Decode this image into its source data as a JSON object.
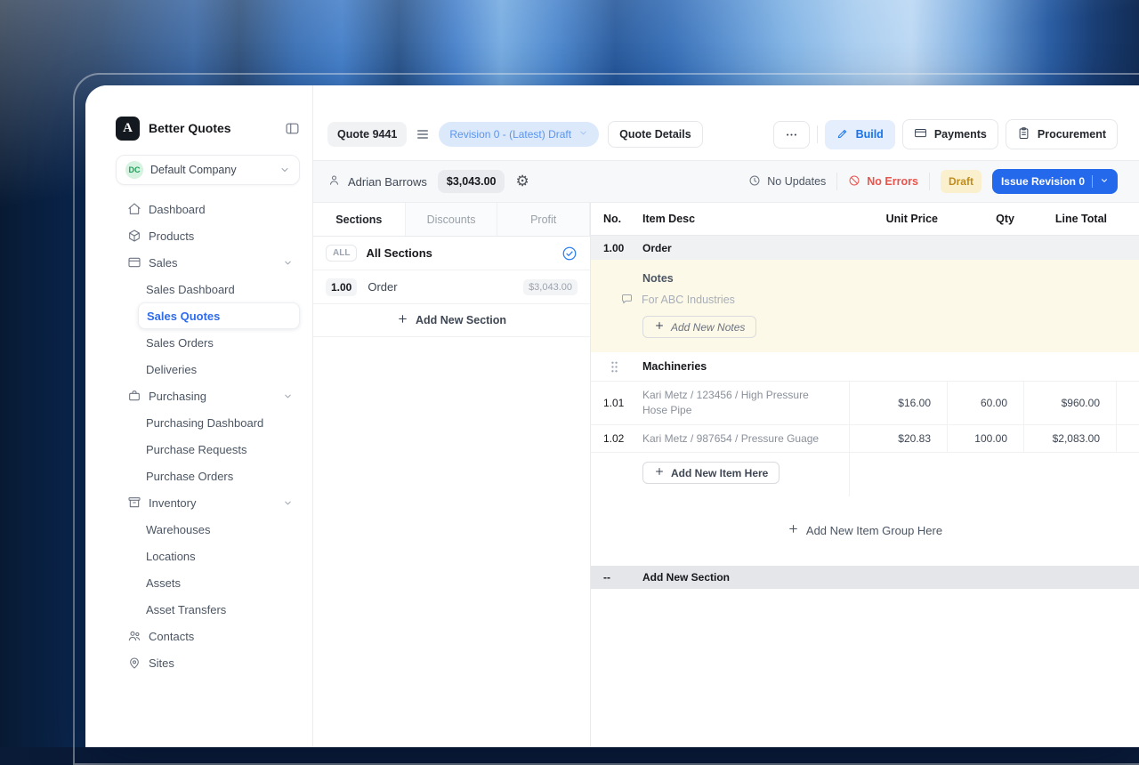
{
  "window": {
    "brand": "Better Quotes",
    "logo_letter": "A"
  },
  "sidebar": {
    "company": {
      "initials": "DC",
      "name": "Default Company"
    },
    "items": [
      {
        "label": "Dashboard"
      },
      {
        "label": "Products"
      },
      {
        "label": "Sales"
      },
      {
        "label": "Sales Dashboard"
      },
      {
        "label": "Sales Quotes"
      },
      {
        "label": "Sales Orders"
      },
      {
        "label": "Deliveries"
      },
      {
        "label": "Purchasing"
      },
      {
        "label": "Purchasing Dashboard"
      },
      {
        "label": "Purchase Requests"
      },
      {
        "label": "Purchase Orders"
      },
      {
        "label": "Inventory"
      },
      {
        "label": "Warehouses"
      },
      {
        "label": "Locations"
      },
      {
        "label": "Assets"
      },
      {
        "label": "Asset Transfers"
      },
      {
        "label": "Contacts"
      },
      {
        "label": "Sites"
      }
    ]
  },
  "header": {
    "quote_badge": "Quote 9441",
    "revision_pill": "Revision 0 - (Latest) Draft",
    "quote_details_button": "Quote Details",
    "build_button": "Build",
    "payments_button": "Payments",
    "procurement_button": "Procurement"
  },
  "subheader": {
    "owner": "Adrian Barrows",
    "total": "$3,043.00",
    "no_updates": "No Updates",
    "no_errors": "No Errors",
    "status_badge": "Draft",
    "issue_button": "Issue Revision 0"
  },
  "sections_panel": {
    "tabs": [
      "Sections",
      "Discounts",
      "Profit"
    ],
    "all_badge": "ALL",
    "all_label": "All Sections",
    "row": {
      "no": "1.00",
      "label": "Order",
      "amount": "$3,043.00"
    },
    "add_section": "Add New Section"
  },
  "items_table": {
    "headers": {
      "no": "No.",
      "desc": "Item Desc",
      "unit_price": "Unit Price",
      "qty": "Qty",
      "line_total": "Line Total"
    },
    "section_row": {
      "no": "1.00",
      "label": "Order"
    },
    "notes": {
      "title": "Notes",
      "text": "For ABC Industries",
      "add_button": "Add New Notes"
    },
    "group_name": "Machineries",
    "items": [
      {
        "no": "1.01",
        "desc": "Kari Metz / 123456 / High Pressure Hose Pipe",
        "unit_price": "$16.00",
        "qty": "60.00",
        "line_total": "$960.00"
      },
      {
        "no": "1.02",
        "desc": "Kari Metz / 987654 / Pressure Guage",
        "unit_price": "$20.83",
        "qty": "100.00",
        "line_total": "$2,083.00"
      }
    ],
    "add_item_button": "Add New Item Here",
    "add_group_button": "Add New Item Group Here",
    "add_section_row": {
      "no": "--",
      "label": "Add New Section"
    }
  },
  "colors": {
    "accent": "#2563eb",
    "build_bg": "#e4eefc",
    "build_text": "#1a73e8",
    "revision_bg": "#dbe9fb",
    "revision_text": "#5b94ee",
    "draft_bg": "#faf0cd",
    "draft_text": "#c08c1d",
    "error": "#e8554d",
    "notes_bg": "#fdf9e8"
  },
  "icons": [
    "panel-toggle",
    "chevron-down",
    "home",
    "box",
    "sales-card",
    "briefcase",
    "archive",
    "people",
    "map-pin",
    "person",
    "gear",
    "clock",
    "error-slash",
    "comment-bubble",
    "plus",
    "pencil",
    "credit-card",
    "clipboard",
    "ellipsis",
    "list",
    "drag-handle",
    "check-circle"
  ]
}
